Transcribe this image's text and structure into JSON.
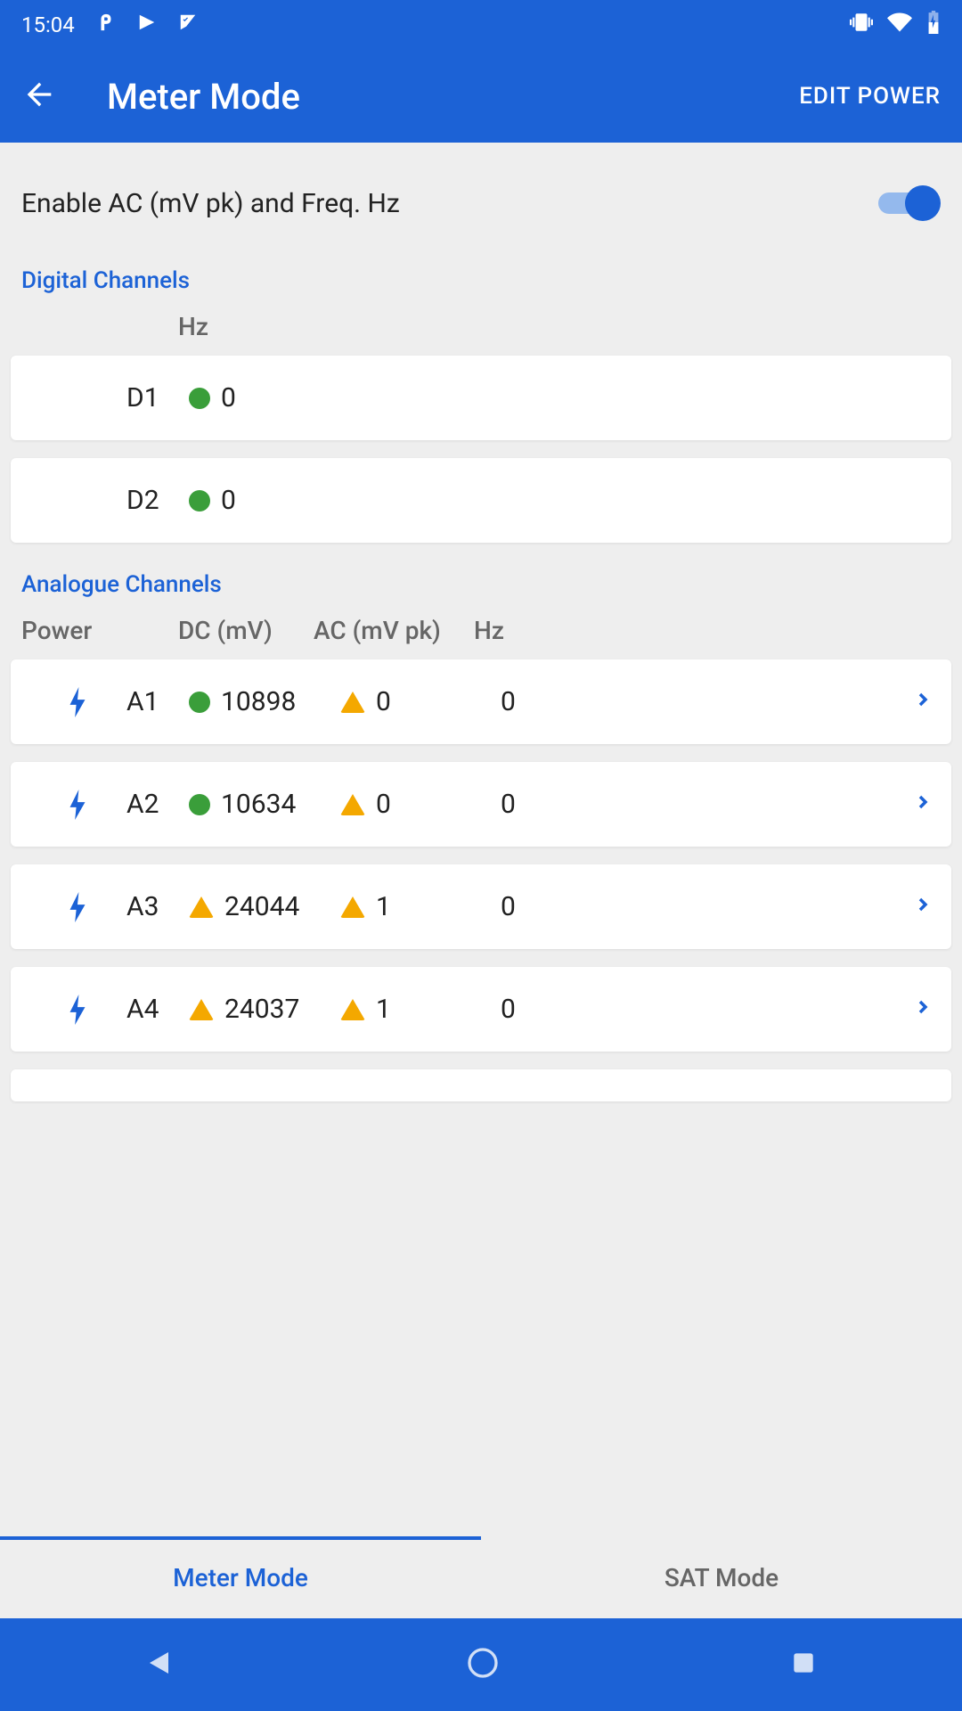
{
  "status_bar": {
    "time": "15:04"
  },
  "app_bar": {
    "title": "Meter Mode",
    "action": "EDIT POWER"
  },
  "toggle": {
    "label": "Enable AC (mV pk) and Freq. Hz"
  },
  "sections": {
    "digital": {
      "title": "Digital Channels",
      "hz_header": "Hz",
      "channels": [
        {
          "name": "D1",
          "hz": "0",
          "status": "green"
        },
        {
          "name": "D2",
          "hz": "0",
          "status": "green"
        }
      ]
    },
    "analogue": {
      "title": "Analogue Channels",
      "headers": {
        "power": "Power",
        "dc": "DC (mV)",
        "ac": "AC (mV pk)",
        "hz": "Hz"
      },
      "channels": [
        {
          "name": "A1",
          "dc": "10898",
          "dc_status": "green",
          "ac": "0",
          "hz": "0"
        },
        {
          "name": "A2",
          "dc": "10634",
          "dc_status": "green",
          "ac": "0",
          "hz": "0"
        },
        {
          "name": "A3",
          "dc": "24044",
          "dc_status": "warning",
          "ac": "1",
          "hz": "0"
        },
        {
          "name": "A4",
          "dc": "24037",
          "dc_status": "warning",
          "ac": "1",
          "hz": "0"
        }
      ]
    }
  },
  "tabs": {
    "meter": "Meter Mode",
    "sat": "SAT Mode"
  }
}
